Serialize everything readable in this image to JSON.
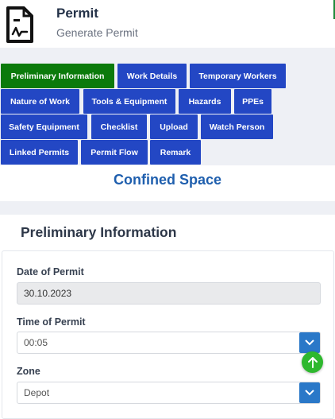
{
  "header": {
    "title": "Permit",
    "subtitle": "Generate Permit"
  },
  "tabs": [
    {
      "label": "Preliminary Information",
      "active": true
    },
    {
      "label": "Work Details"
    },
    {
      "label": "Temporary Workers"
    },
    {
      "label": "Nature of Work"
    },
    {
      "label": "Tools & Equipment"
    },
    {
      "label": "Hazards"
    },
    {
      "label": "PPEs"
    },
    {
      "label": "Safety Equipment"
    },
    {
      "label": "Checklist"
    },
    {
      "label": "Upload"
    },
    {
      "label": "Watch Person"
    },
    {
      "label": "Linked Permits"
    },
    {
      "label": "Permit Flow"
    },
    {
      "label": "Remark"
    }
  ],
  "permit_type": "Confined Space",
  "section": {
    "title": "Preliminary Information"
  },
  "fields": {
    "date": {
      "label": "Date of Permit",
      "value": "30.10.2023"
    },
    "time": {
      "label": "Time of Permit",
      "value": "00:05"
    },
    "zone": {
      "label": "Zone",
      "value": "Depot"
    }
  },
  "icons": {
    "header": "permit-document-icon",
    "dropdown": "chevron-down-icon",
    "scroll_top": "arrow-up-icon"
  },
  "colors": {
    "tab_active": "#0b7a0b",
    "tab": "#2347c4",
    "accent_title": "#1f5fae",
    "select_button": "#2a78c8",
    "fab": "#2eb82e"
  }
}
